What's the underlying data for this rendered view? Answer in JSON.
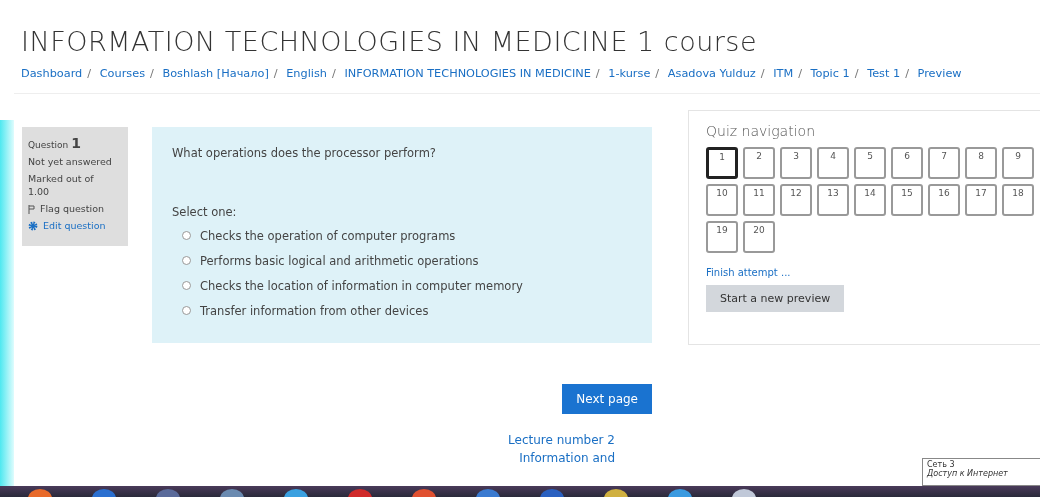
{
  "page_title": "INFORMATION TECHNOLOGIES IN MEDICINE 1 course",
  "breadcrumb_separator": "/",
  "breadcrumb": [
    "Dashboard",
    "Courses",
    "Boshlash [Начало]",
    "English",
    "INFORMATION TECHNOLOGIES IN MEDICINE",
    "1-kurse",
    "Asadova Yulduz",
    "ITM",
    "Topic 1",
    "Test 1",
    "Preview"
  ],
  "question_info": {
    "label": "Question",
    "number": "1",
    "status": "Not yet answered",
    "marks": "Marked out of 1.00",
    "flag": "Flag question",
    "edit": "Edit question"
  },
  "question": {
    "text": "What operations does the processor perform?",
    "prompt": "Select one:",
    "options": [
      {
        "label": "Checks the operation of computer programs",
        "selected": false
      },
      {
        "label": "Performs basic logical and arithmetic operations",
        "selected": false
      },
      {
        "label": "Checks the location of information in computer memory",
        "selected": false
      },
      {
        "label": "Transfer information from other devices",
        "selected": false
      }
    ]
  },
  "next_button": "Next page",
  "next_activity": [
    "Lecture number 2",
    "Information and"
  ],
  "quiz_navigation": {
    "title": "Quiz navigation",
    "questions": [
      {
        "label": "1",
        "selected": true
      },
      {
        "label": "2",
        "selected": false
      },
      {
        "label": "3",
        "selected": false
      },
      {
        "label": "4",
        "selected": false
      },
      {
        "label": "5",
        "selected": false
      },
      {
        "label": "6",
        "selected": false
      },
      {
        "label": "7",
        "selected": false
      },
      {
        "label": "8",
        "selected": false
      },
      {
        "label": "9",
        "selected": false
      },
      {
        "label": "10",
        "selected": false
      },
      {
        "label": "11",
        "selected": false
      },
      {
        "label": "12",
        "selected": false
      },
      {
        "label": "13",
        "selected": false
      },
      {
        "label": "14",
        "selected": false
      },
      {
        "label": "15",
        "selected": false
      },
      {
        "label": "16",
        "selected": false
      },
      {
        "label": "17",
        "selected": false
      },
      {
        "label": "18",
        "selected": false
      },
      {
        "label": "19",
        "selected": false
      },
      {
        "label": "20",
        "selected": false
      }
    ],
    "finish": "Finish attempt ...",
    "new_preview": "Start a new preview"
  },
  "tooltip": {
    "title": "Сеть 3",
    "text": "Доступ к Интернет"
  }
}
